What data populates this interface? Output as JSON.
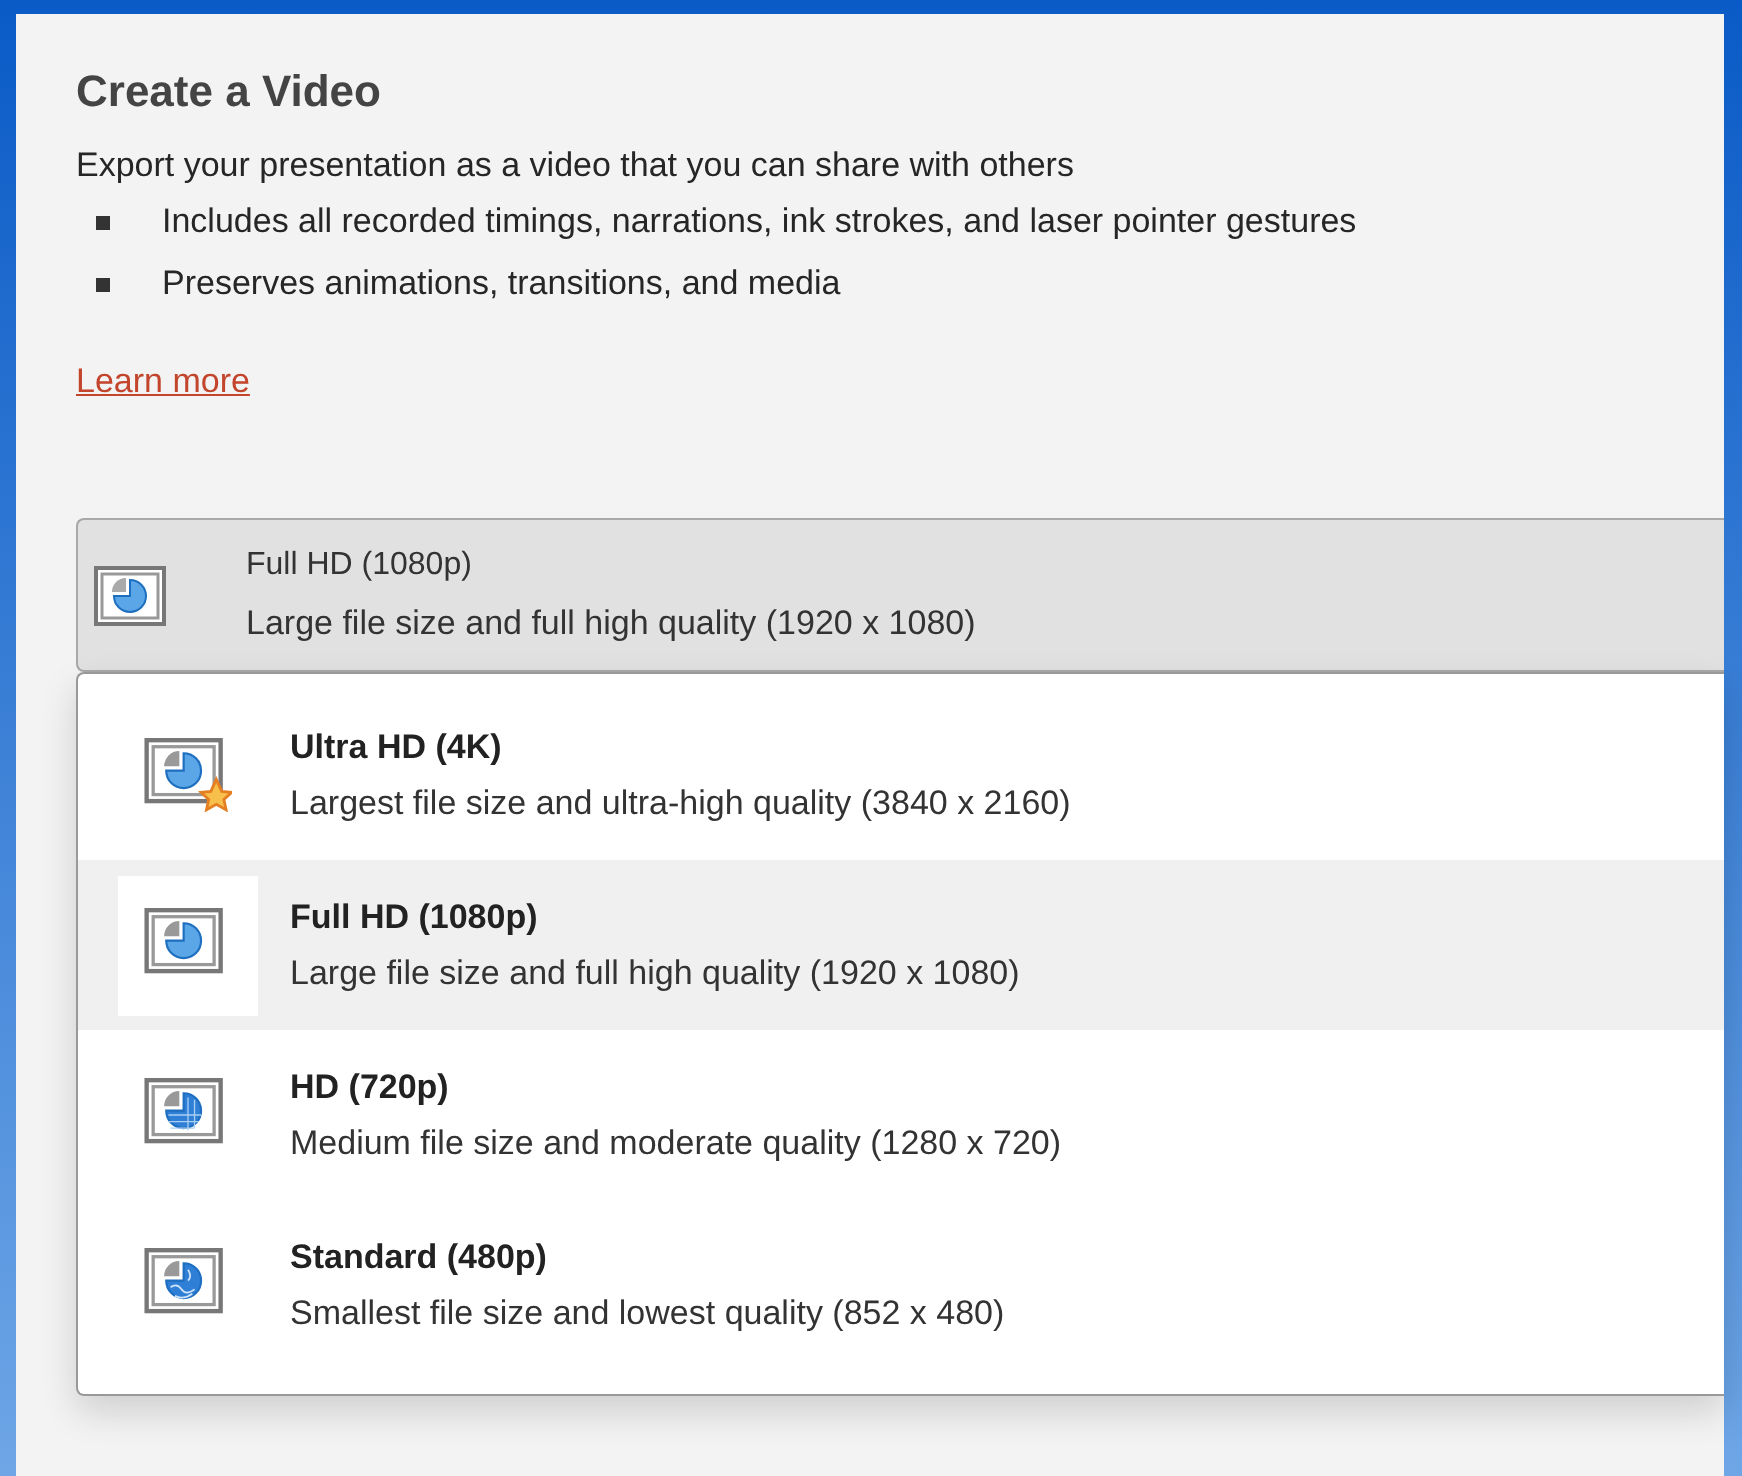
{
  "heading": "Create a Video",
  "description": "Export your presentation as a video that you can share with others",
  "bullets": [
    "Includes all recorded timings, narrations, ink strokes, and laser pointer gestures",
    "Preserves animations, transitions, and media"
  ],
  "learn_more": "Learn more",
  "dropdown": {
    "title": "Full HD (1080p)",
    "subtitle": "Large file size and full high quality (1920 x 1080)",
    "options": [
      {
        "kind": "ultra",
        "title": "Ultra HD (4K)",
        "subtitle": "Largest file size and ultra-high quality (3840 x 2160)",
        "selected": false
      },
      {
        "kind": "full",
        "title": "Full HD (1080p)",
        "subtitle": "Large file size and full high quality (1920 x 1080)",
        "selected": true
      },
      {
        "kind": "hd",
        "title": "HD (720p)",
        "subtitle": "Medium file size and moderate quality (1280 x 720)",
        "selected": false
      },
      {
        "kind": "standard",
        "title": "Standard (480p)",
        "subtitle": "Smallest file size and lowest quality (852 x 480)",
        "selected": false
      }
    ]
  }
}
